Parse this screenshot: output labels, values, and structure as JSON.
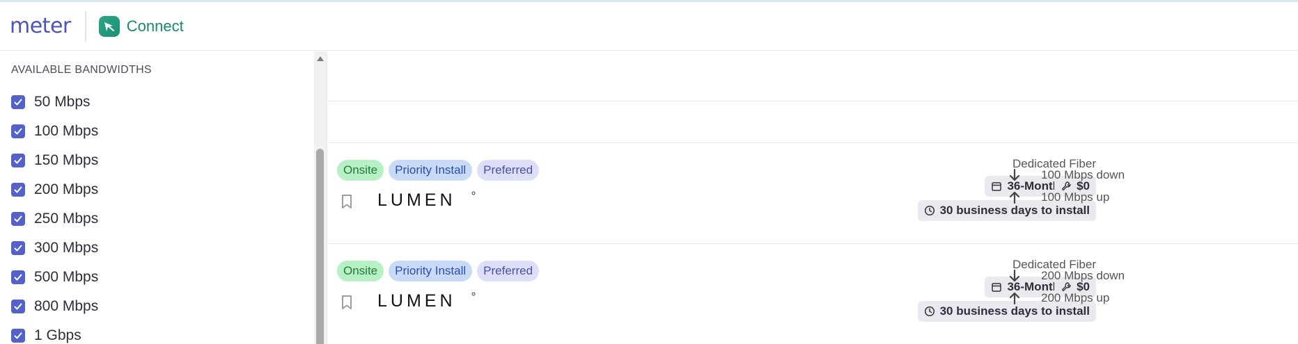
{
  "header": {
    "logo_text": "meter",
    "product_name": "Connect",
    "product_icon": "connect-app-icon"
  },
  "sidebar": {
    "heading": "AVAILABLE BANDWIDTHS",
    "items": [
      {
        "label": "50 Mbps",
        "checked": true
      },
      {
        "label": "100 Mbps",
        "checked": true
      },
      {
        "label": "150 Mbps",
        "checked": true
      },
      {
        "label": "200 Mbps",
        "checked": true
      },
      {
        "label": "250 Mbps",
        "checked": true
      },
      {
        "label": "300 Mbps",
        "checked": true
      },
      {
        "label": "500 Mbps",
        "checked": true
      },
      {
        "label": "800 Mbps",
        "checked": true
      },
      {
        "label": "1 Gbps",
        "checked": true
      }
    ]
  },
  "quotes": [
    {
      "tags": [
        "Onsite",
        "Priority Install",
        "Preferred"
      ],
      "provider": "LUMEN",
      "connection_type": "Dedicated Fiber",
      "term": "36-Month",
      "install_cost": "$0",
      "install_time": "30 business days to install",
      "download": "100 Mbps down",
      "upload": "100 Mbps up"
    },
    {
      "tags": [
        "Onsite",
        "Priority Install",
        "Preferred"
      ],
      "provider": "LUMEN",
      "connection_type": "Dedicated Fiber",
      "term": "36-Month",
      "install_cost": "$0",
      "install_time": "30 business days to install",
      "download": "200 Mbps down",
      "upload": "200 Mbps up"
    }
  ],
  "colors": {
    "brand": "#4c55b6",
    "connect_green": "#188a6f",
    "checkbox": "#5461c8",
    "tag_onsite_bg": "#b7f0c4",
    "tag_priority_bg": "#c9daf8",
    "tag_preferred_bg": "#dcdff7"
  }
}
